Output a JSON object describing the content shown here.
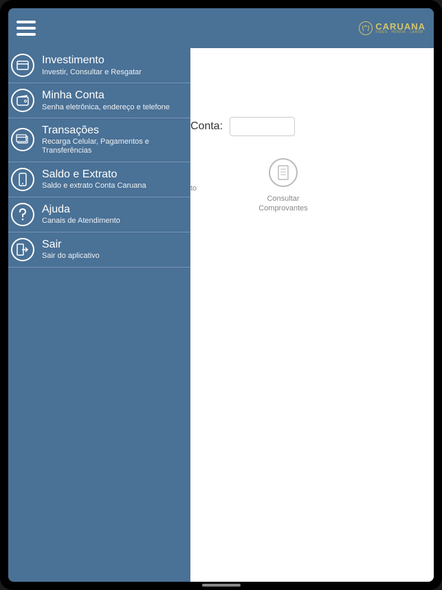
{
  "brand": {
    "name": "CARUANA",
    "tagline": "FIDES · HONOR · LABOR"
  },
  "sidebar": {
    "items": [
      {
        "title": "Investimento",
        "desc": "Investir, Consultar e Resgatar",
        "icon": "card-icon"
      },
      {
        "title": "Minha Conta",
        "desc": "Senha eletrônica, endereço e telefone",
        "icon": "wallet-icon"
      },
      {
        "title": "Transações",
        "desc": "Recarga Celular, Pagamentos e Transferências",
        "icon": "cards-icon"
      },
      {
        "title": "Saldo e Extrato",
        "desc": "Saldo e extrato Conta Caruana",
        "icon": "phone-icon"
      },
      {
        "title": "Ajuda",
        "desc": "Canais de Atendimento",
        "icon": "help-icon"
      },
      {
        "title": "Sair",
        "desc": "Sair do aplicativo",
        "icon": "exit-icon"
      }
    ]
  },
  "main": {
    "conta_label": "Conta:",
    "conta_value": "",
    "partial_action": "to",
    "action": {
      "label": "Consultar Comprovantes",
      "icon": "receipt-icon"
    }
  }
}
